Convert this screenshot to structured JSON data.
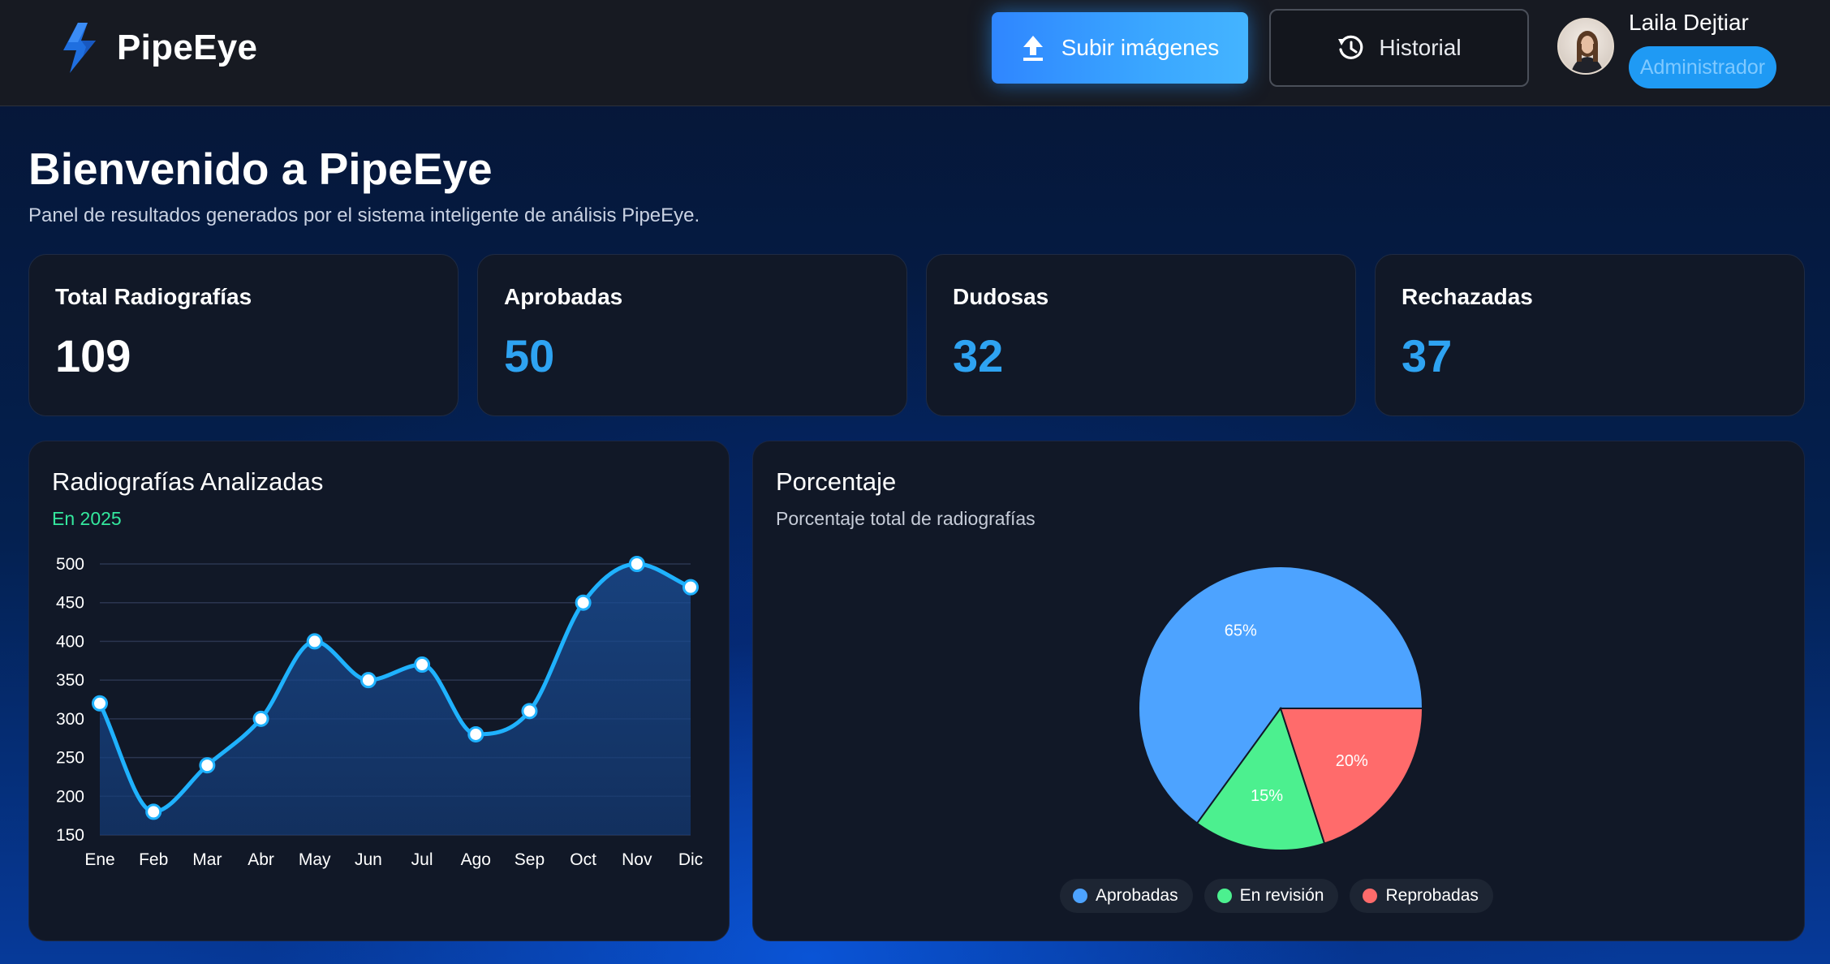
{
  "header": {
    "brand": "PipeEye",
    "upload_label": "Subir imágenes",
    "history_label": "Historial",
    "user_name": "Laila Dejtiar",
    "user_role": "Administrador"
  },
  "hero": {
    "title": "Bienvenido a PipeEye",
    "subtitle": "Panel de resultados generados por el sistema inteligente de análisis PipeEye."
  },
  "stats": [
    {
      "label": "Total Radiografías",
      "value": "109",
      "color": "#ffffff"
    },
    {
      "label": "Aprobadas",
      "value": "50",
      "color": "#2ea3f2"
    },
    {
      "label": "Dudosas",
      "value": "32",
      "color": "#2ea3f2"
    },
    {
      "label": "Rechazadas",
      "value": "37",
      "color": "#2ea3f2"
    }
  ],
  "line_panel": {
    "title": "Radiografías Analizadas",
    "subtitle": "En 2025",
    "subtitle_color": "#34e89e"
  },
  "pie_panel": {
    "title": "Porcentaje",
    "subtitle": "Porcentaje total de radiografías"
  },
  "legend": [
    {
      "label": "Aprobadas",
      "color": "#4da3ff"
    },
    {
      "label": "En revisión",
      "color": "#4cf08f"
    },
    {
      "label": "Reprobadas",
      "color": "#ff6b6b"
    }
  ],
  "chart_data": [
    {
      "type": "line",
      "title": "Radiografías Analizadas",
      "subtitle": "En 2025",
      "categories": [
        "Ene",
        "Feb",
        "Mar",
        "Abr",
        "May",
        "Jun",
        "Jul",
        "Ago",
        "Sep",
        "Oct",
        "Nov",
        "Dic"
      ],
      "series": [
        {
          "values": [
            320,
            180,
            240,
            300,
            400,
            350,
            370,
            280,
            310,
            450,
            500,
            470
          ],
          "color": "#1fb2ff"
        }
      ],
      "yticks": [
        150,
        200,
        250,
        300,
        350,
        400,
        450,
        500
      ],
      "ylim": [
        150,
        500
      ],
      "grid": true
    },
    {
      "type": "pie",
      "title": "Porcentaje",
      "subtitle": "Porcentaje total de radiografías",
      "slices": [
        {
          "label": "Aprobadas",
          "value": 65,
          "text": "65%",
          "color": "#4da3ff"
        },
        {
          "label": "En revisión",
          "value": 15,
          "text": "15%",
          "color": "#4cf08f"
        },
        {
          "label": "Reprobadas",
          "value": 20,
          "text": "20%",
          "color": "#ff6b6b"
        }
      ],
      "legend_position": "bottom"
    }
  ]
}
